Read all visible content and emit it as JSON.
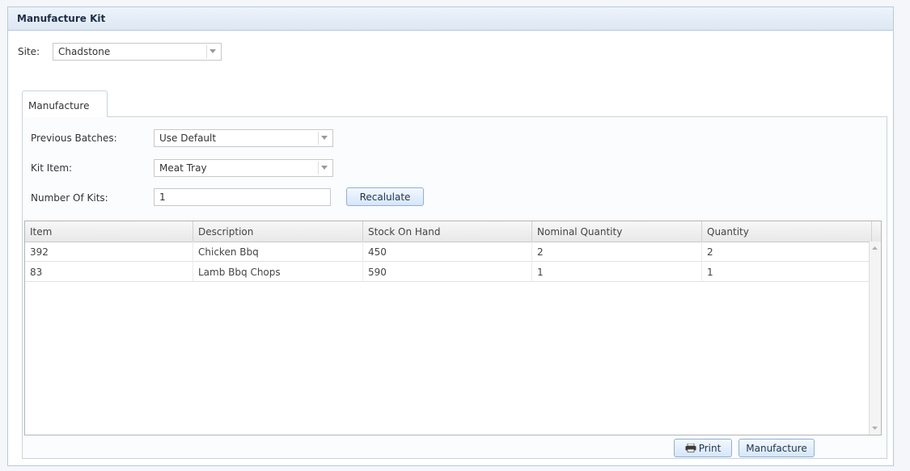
{
  "window": {
    "title": "Manufacture Kit"
  },
  "site": {
    "label": "Site:",
    "value": "Chadstone"
  },
  "tabs": [
    {
      "label": "Manufacture",
      "active": true
    }
  ],
  "form": {
    "previous_batches": {
      "label": "Previous Batches:",
      "value": "Use Default"
    },
    "kit_item": {
      "label": "Kit Item:",
      "value": "Meat Tray"
    },
    "number_of_kits": {
      "label": "Number Of Kits:",
      "value": "1"
    },
    "recalculate_label": "Recalulate"
  },
  "grid": {
    "columns": [
      "Item",
      "Description",
      "Stock On Hand",
      "Nominal Quantity",
      "Quantity"
    ],
    "rows": [
      [
        "392",
        "Chicken Bbq",
        "450",
        "2",
        "2"
      ],
      [
        "83",
        "Lamb Bbq Chops",
        "590",
        "1",
        "1"
      ]
    ]
  },
  "footer": {
    "print_label": "Print",
    "manufacture_label": "Manufacture"
  },
  "icons": {
    "combo_arrow": "chevron-down-icon",
    "print": "printer-icon",
    "scroll_up": "scroll-up-arrow-icon",
    "scroll_down": "scroll-down-arrow-icon"
  },
  "colors": {
    "accent": "#8fb0d6",
    "title_text": "#1c2f4a",
    "border": "#b7c9de"
  }
}
